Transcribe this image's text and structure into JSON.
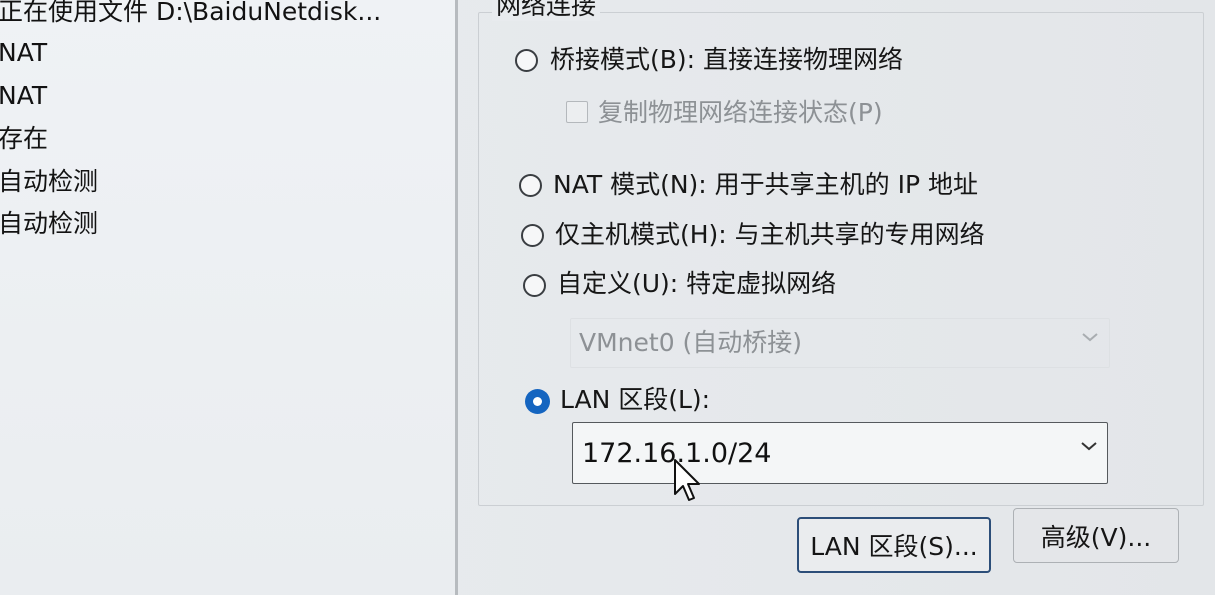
{
  "left_panel": {
    "values": [
      "正在使用文件 D:\\BaiduNetdisk...",
      "NAT",
      "NAT",
      "存在",
      "自动检测",
      "自动检测"
    ]
  },
  "network_connection": {
    "title": "网络连接",
    "bridged": {
      "label": "桥接模式(B): 直接连接物理网络",
      "selected": false
    },
    "replicate_state": {
      "label": "复制物理网络连接状态(P)",
      "checked": false,
      "enabled": false
    },
    "nat": {
      "label": "NAT 模式(N): 用于共享主机的 IP 地址",
      "selected": false
    },
    "host_only": {
      "label": "仅主机模式(H): 与主机共享的专用网络",
      "selected": false
    },
    "custom": {
      "label": "自定义(U): 特定虚拟网络",
      "selected": false
    },
    "custom_network_select": {
      "value": "VMnet0 (自动桥接)",
      "enabled": false
    },
    "lan_segment": {
      "label": "LAN 区段(L):",
      "selected": true
    },
    "lan_segment_select": {
      "value": "172.16.1.0/24",
      "enabled": true
    }
  },
  "buttons": {
    "lan_segments": "LAN 区段(S)...",
    "advanced": "高级(V)..."
  },
  "icons": {
    "dropdown": "chevron-down-icon",
    "cursor": "mouse-cursor-icon"
  },
  "colors": {
    "selected_radio": "#1565c0",
    "disabled_text": "#8d9195",
    "focused_button_border": "#2c4e79"
  }
}
